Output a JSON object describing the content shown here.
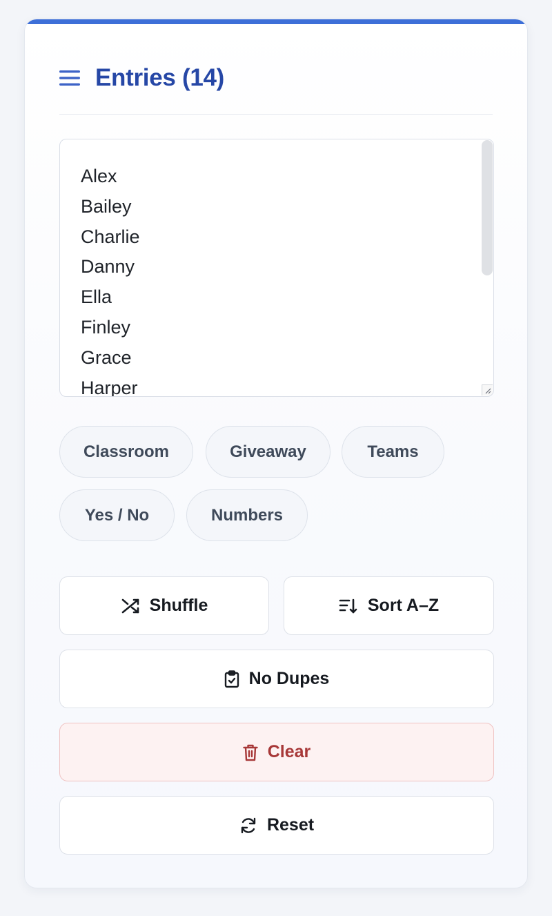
{
  "header": {
    "title": "Entries (14)",
    "menu_icon": "hamburger-menu-icon"
  },
  "entries": [
    "Alex",
    "Bailey",
    "Charlie",
    "Danny",
    "Ella",
    "Finley",
    "Grace",
    "Harper"
  ],
  "presets": [
    "Classroom",
    "Giveaway",
    "Teams",
    "Yes / No",
    "Numbers"
  ],
  "actions": {
    "shuffle": {
      "label": "Shuffle",
      "icon": "shuffle-icon"
    },
    "sort": {
      "label": "Sort A–Z",
      "icon": "sort-icon"
    },
    "no_dupes": {
      "label": "No Dupes",
      "icon": "clipboard-check-icon"
    },
    "clear": {
      "label": "Clear",
      "icon": "trash-icon"
    },
    "reset": {
      "label": "Reset",
      "icon": "refresh-icon"
    }
  },
  "colors": {
    "accent": "#3d6fd8",
    "title": "#2647a6",
    "danger": "#a73838"
  }
}
